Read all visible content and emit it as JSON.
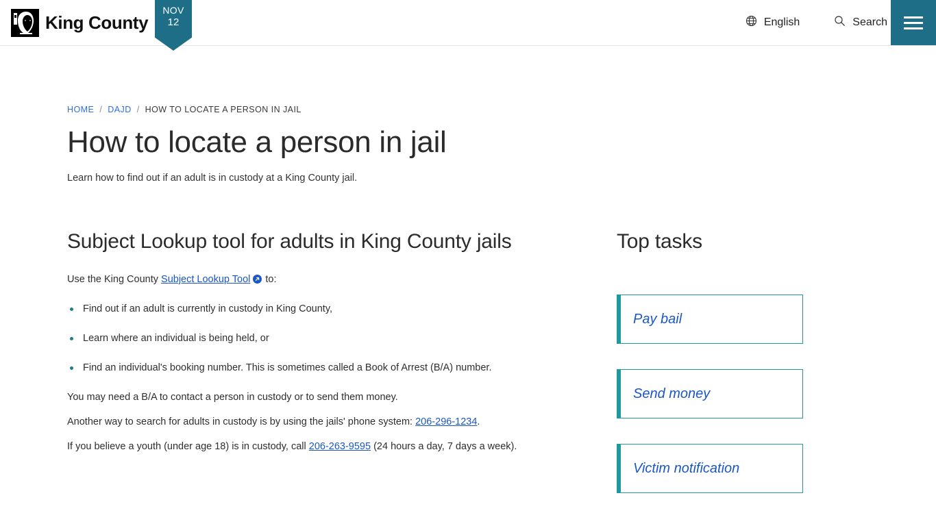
{
  "header": {
    "brand_name": "King County",
    "brand_logo_icon": "king-county-face-logo",
    "date_ribbon": {
      "month": "NOV",
      "day": "12"
    },
    "language": {
      "label": "English",
      "icon": "globe-icon"
    },
    "search": {
      "label": "Search",
      "icon": "search-icon"
    },
    "menu": {
      "icon": "hamburger-menu-icon",
      "label": "Menu"
    },
    "accent_color": "#1f6e87"
  },
  "breadcrumb": {
    "items": [
      {
        "label": "HOME",
        "is_link": true
      },
      {
        "label": "DAJD",
        "is_link": true
      },
      {
        "label": "HOW TO LOCATE A PERSON IN JAIL",
        "is_link": false
      }
    ],
    "separator": "/"
  },
  "page": {
    "title": "How to locate a person in jail",
    "subtitle": "Learn how to find out if an adult is in custody at a King County jail."
  },
  "main": {
    "heading": "Subject Lookup tool for adults in King County jails",
    "intro_prefix": "Use the King County ",
    "intro_link": "Subject Lookup Tool",
    "intro_link_icon": "external-link-icon",
    "intro_suffix": " to:",
    "bullets": [
      "Find out if an adult is currently in custody in King County,",
      "Learn where an individual is being held, or",
      "Find an individual's booking number. This is sometimes called a Book of Arrest (B/A) number."
    ],
    "note_1": "You may need a B/A to contact a person in custody or to send them money.",
    "note_2_prefix": "Another way to search for adults in custody is by using the jails' phone system: ",
    "note_2_phone": "206-296-1234",
    "note_2_suffix": ".",
    "note_3_prefix": "If you believe a youth (under age 18) is in custody, call ",
    "note_3_phone": "206-263-9595",
    "note_3_suffix": " (24 hours a day, 7 days a week)."
  },
  "sidebar": {
    "heading": "Top tasks",
    "cards": [
      {
        "label": "Pay bail"
      },
      {
        "label": "Send money"
      },
      {
        "label": "Victim notification"
      }
    ],
    "accent_color": "#20999c",
    "link_color": "#1a56c4"
  }
}
